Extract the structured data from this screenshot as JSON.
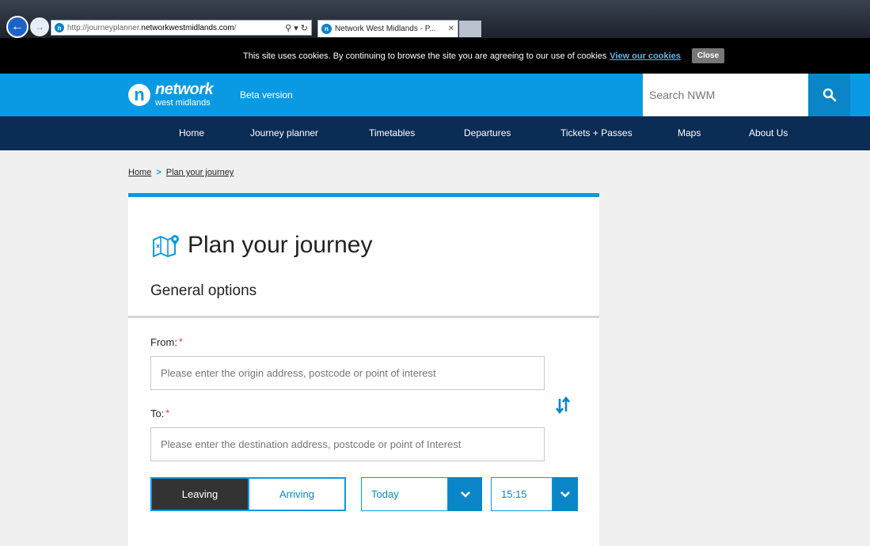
{
  "browser": {
    "url_prefix": "http://journeyplanner.",
    "url_domain": "networkwestmidlands.com",
    "url_suffix": "/",
    "address_tools": "⚲ ▾ ↻",
    "tab_title": "Network West Midlands - P...",
    "favicon_letter": "n"
  },
  "cookie_bar": {
    "message": "This site uses cookies. By continuing to browse the site you are agreeing to our use of cookies",
    "link": "View our cookies",
    "close": "Close"
  },
  "header": {
    "logo_letter": "n",
    "logo_word": "network",
    "logo_sub": "west midlands",
    "beta": "Beta version",
    "search_placeholder": "Search NWM",
    "color": "#0a9ae4"
  },
  "nav": {
    "items": [
      "Home",
      "Journey planner",
      "Timetables",
      "Departures",
      "Tickets + Passes",
      "Maps",
      "About Us"
    ]
  },
  "breadcrumb": {
    "home": "Home",
    "separator": ">",
    "current": "Plan your journey"
  },
  "planner": {
    "title": "Plan your journey",
    "section": "General options",
    "from_label": "From:",
    "from_placeholder": "Please enter the origin address, postcode or point of interest",
    "to_label": "To:",
    "to_placeholder": "Please enter the destination address, postcode or point of Interest",
    "required_mark": "*",
    "leaving": "Leaving",
    "arriving": "Arriving",
    "day": "Today",
    "time": "15:15"
  }
}
